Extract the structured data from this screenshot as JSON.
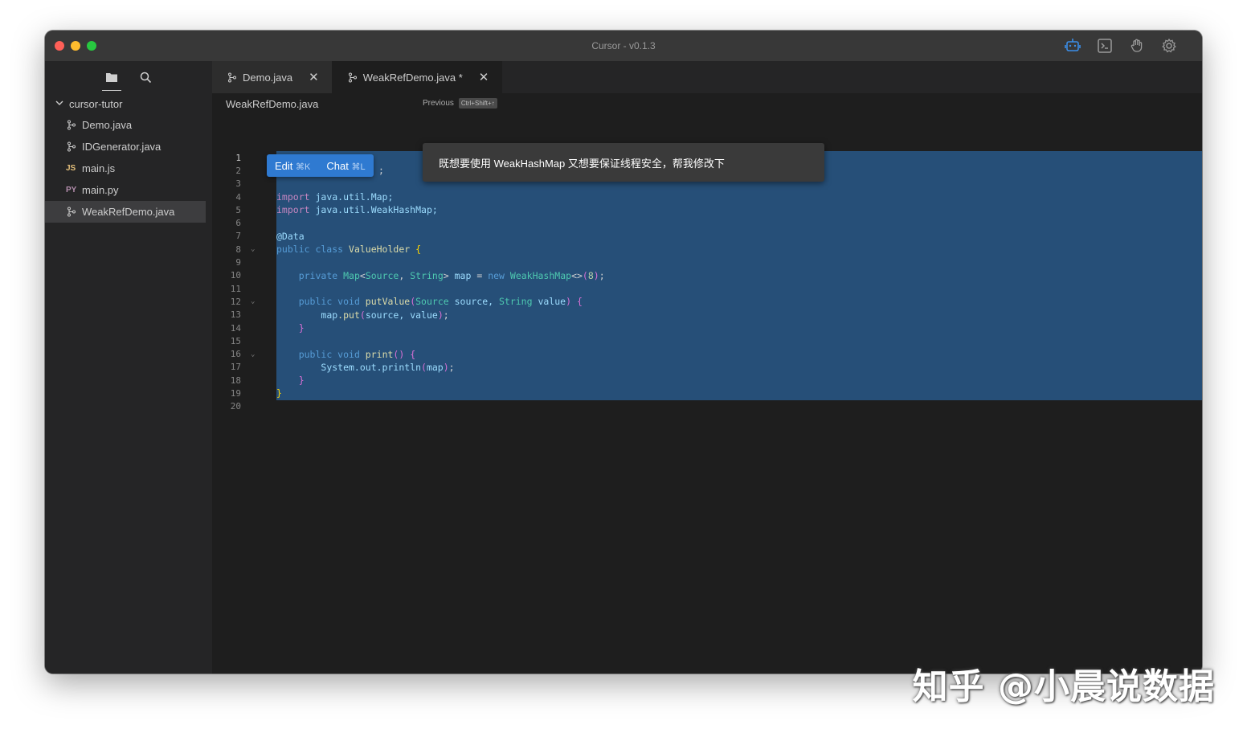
{
  "window": {
    "title": "Cursor - v0.1.3"
  },
  "title_tools": [
    "robot-icon",
    "terminal-icon",
    "hand-icon",
    "gear-icon"
  ],
  "sidebar": {
    "root": "cursor-tutor",
    "items": [
      {
        "label": "Demo.java",
        "type": "java"
      },
      {
        "label": "IDGenerator.java",
        "type": "java"
      },
      {
        "label": "main.js",
        "type": "js",
        "badge": "JS"
      },
      {
        "label": "main.py",
        "type": "py",
        "badge": "PY"
      },
      {
        "label": "WeakRefDemo.java",
        "type": "java",
        "selected": true
      }
    ]
  },
  "tabs": [
    {
      "label": "Demo.java",
      "close": "✕"
    },
    {
      "label": "WeakRefDemo.java *",
      "close": "✕"
    }
  ],
  "breadcrumb": {
    "file": "WeakRefDemo.java",
    "previous_label": "Previous",
    "previous_shortcut": "Ctrl+Shift+↑"
  },
  "inline_actions": {
    "edit": "Edit",
    "edit_shortcut": "⌘K",
    "chat": "Chat",
    "chat_shortcut": "⌘L"
  },
  "prompt": {
    "text": "既想要使用 WeakHashMap 又想要保证线程安全，帮我修改下"
  },
  "code": {
    "line_numbers": [
      "1",
      "2",
      "3",
      "4",
      "5",
      "6",
      "7",
      "8",
      "9",
      "10",
      "11",
      "12",
      "13",
      "14",
      "15",
      "16",
      "17",
      "18",
      "19",
      "20"
    ],
    "line2_tail": ";",
    "import1_kw": "import",
    "import1_rest": " java.util.Map;",
    "import2_kw": "import",
    "import2_rest": " java.util.WeakHashMap;",
    "annotation": "@Data",
    "class_mod": "public class",
    "class_name": " ValueHolder ",
    "class_open": "{",
    "field_mod": "private",
    "field_type": " Map",
    "field_gen1": "<",
    "field_src": "Source",
    "field_comma": ", ",
    "field_str": "String",
    "field_gen2": ">",
    "field_name": " map",
    "field_eq": " = ",
    "field_new": "new",
    "field_ctor": " WeakHashMap",
    "field_diamond": "<>",
    "field_p1": "(",
    "field_num": "8",
    "field_p2": ")",
    "field_end": ";",
    "put_mod": "public void",
    "put_name": " putValue",
    "put_p1": "(",
    "put_t1": "Source",
    "put_a1": " source, ",
    "put_t2": "String",
    "put_a2": " value",
    "put_p2": ")",
    "put_open": " {",
    "put_body1": "map",
    "put_body2": ".put",
    "put_bp1": "(",
    "put_body3": "source, value",
    "put_bp2": ")",
    "put_body4": ";",
    "close_brace": "}",
    "print_mod": "public void",
    "print_name": " print",
    "print_paren": "()",
    "print_open": " {",
    "print_body1": "System.out.println",
    "print_bp1": "(",
    "print_body2": "map",
    "print_bp2": ")",
    "print_body3": ";",
    "final_brace": "}"
  },
  "watermark": "知乎 @小晨说数据"
}
